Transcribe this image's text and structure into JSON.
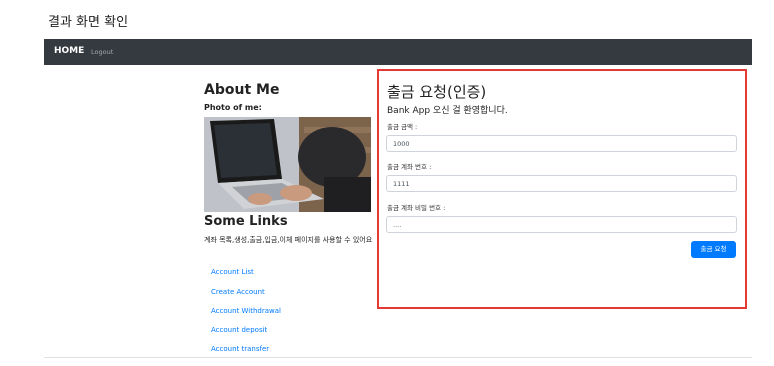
{
  "caption": "결과 화면 확인",
  "navbar": {
    "home": "HOME",
    "logout": "Logout"
  },
  "sidebar": {
    "about_title": "About Me",
    "photo_label": "Photo of me:",
    "links_title": "Some Links",
    "links_desc": "계좌 목록,생성,출금,입금,이체 페이지를 사용할 수 있어요",
    "links": [
      "Account List",
      "Create Account",
      "Account Withdrawal",
      "Account deposit",
      "Account transfer"
    ]
  },
  "form": {
    "title": "출금 요청(인증)",
    "subtitle": "Bank App 오신 걸 환영합니다.",
    "amount_label": "출금 금액 :",
    "amount_value": "1000",
    "account_label": "출금 계좌 번호 :",
    "account_value": "1111",
    "password_label": "출금 계좌 비밀 번호 :",
    "password_value": "....",
    "submit_label": "출금 요청"
  },
  "colors": {
    "navbar": "#343a40",
    "link": "#007bff",
    "highlight_border": "#e53935",
    "button": "#007bff"
  }
}
